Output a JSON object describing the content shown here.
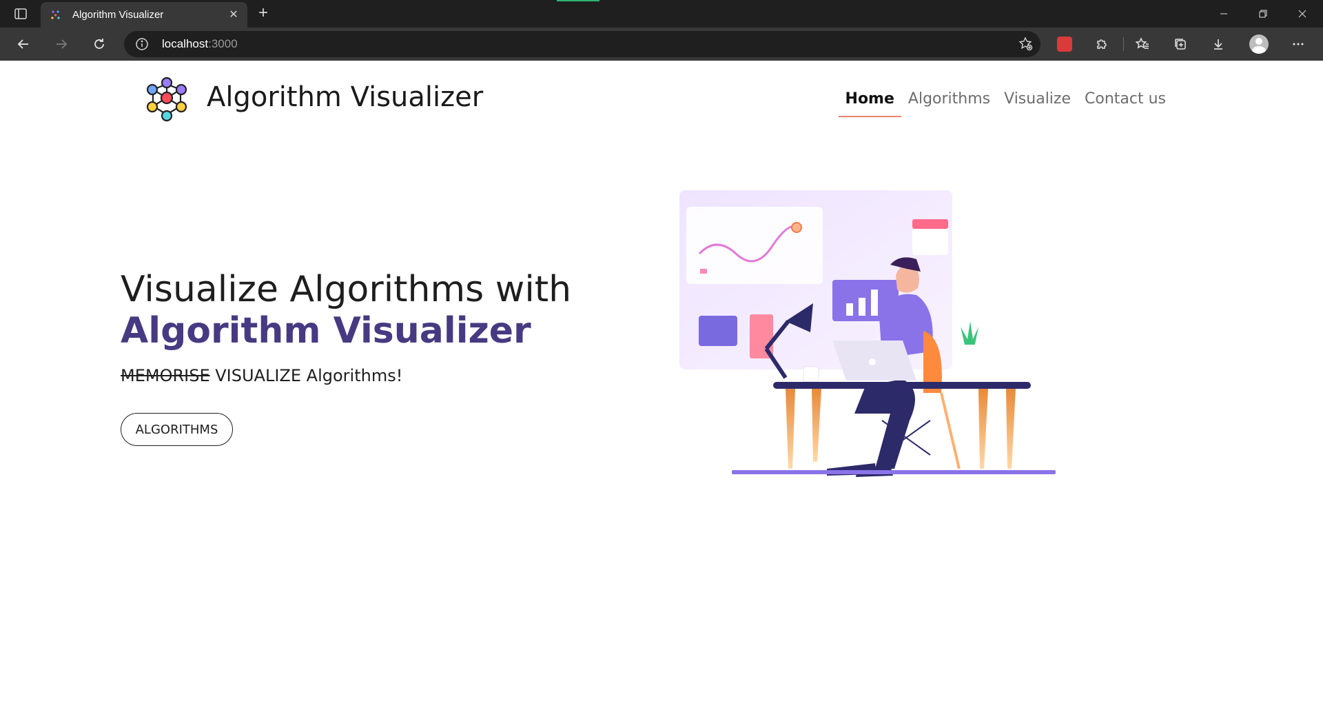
{
  "browser": {
    "tab_title": "Algorithm Visualizer",
    "url_host": "localhost",
    "url_port": ":3000"
  },
  "site": {
    "brand": "Algorithm Visualizer",
    "nav": [
      {
        "label": "Home",
        "active": true
      },
      {
        "label": "Algorithms",
        "active": false
      },
      {
        "label": "Visualize",
        "active": false
      },
      {
        "label": "Contact us",
        "active": false
      }
    ]
  },
  "hero": {
    "title_line1": "Visualize Algorithms with",
    "title_line2": "Algorithm Visualizer",
    "subtitle_struck": "MEMORISE",
    "subtitle_rest": " VISUALIZE Algorithms!",
    "button_label": "ALGORITHMS"
  },
  "colors": {
    "accent": "#473a82",
    "nav_underline": "#e8836b",
    "illustration_purple": "#8a73e8"
  }
}
